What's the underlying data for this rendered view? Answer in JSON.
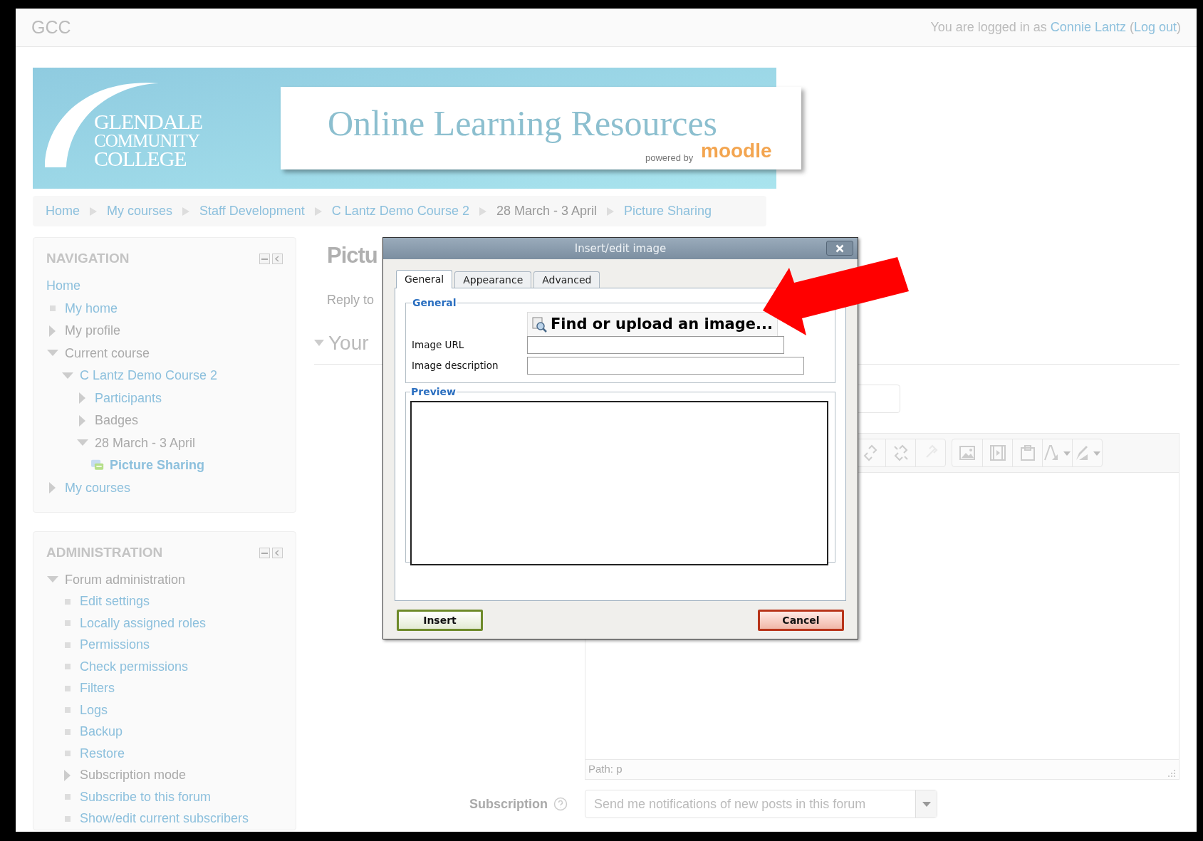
{
  "header": {
    "site": "GCC",
    "login": {
      "before": "You are logged in as",
      "user": "Connie Lantz",
      "open": "(",
      "logout": "Log out",
      "close": ")"
    }
  },
  "banner": {
    "college_lines": [
      "GLENDALE",
      "COMMUNITY",
      "COLLEGE"
    ],
    "title": "Online Learning Resources",
    "powered_by": "powered by",
    "brand": "moodle"
  },
  "breadcrumb": [
    {
      "label": "Home",
      "link": true
    },
    {
      "label": "My courses",
      "link": true
    },
    {
      "label": "Staff Development",
      "link": true
    },
    {
      "label": "C Lantz Demo Course 2",
      "link": true
    },
    {
      "label": "28 March - 3 April",
      "link": false
    },
    {
      "label": "Picture Sharing",
      "link": true
    }
  ],
  "navigation": {
    "title": "NAVIGATION",
    "items": [
      {
        "label": "Home",
        "kind": "root",
        "link": true
      },
      {
        "label": "My home",
        "kind": "leaf",
        "link": true
      },
      {
        "label": "My profile",
        "kind": "branch",
        "link": false,
        "expanded": false
      },
      {
        "label": "Current course",
        "kind": "branch",
        "link": false,
        "expanded": true,
        "children": [
          {
            "label": "C Lantz Demo Course 2",
            "kind": "branch",
            "link": true,
            "expanded": true,
            "children": [
              {
                "label": "Participants",
                "kind": "branch",
                "link": true,
                "expanded": false
              },
              {
                "label": "Badges",
                "kind": "branch",
                "link": false,
                "expanded": false
              },
              {
                "label": "28 March - 3 April",
                "kind": "branch",
                "link": false,
                "expanded": true,
                "children": [
                  {
                    "label": "Picture Sharing",
                    "kind": "activity",
                    "link": true
                  }
                ]
              }
            ]
          }
        ]
      },
      {
        "label": "My courses",
        "kind": "branch",
        "link": true,
        "expanded": false
      }
    ]
  },
  "administration": {
    "title": "ADMINISTRATION",
    "items": [
      {
        "label": "Forum administration",
        "kind": "branch",
        "link": false,
        "expanded": true,
        "children": [
          {
            "label": "Edit settings",
            "kind": "leaf",
            "link": true
          },
          {
            "label": "Locally assigned roles",
            "kind": "leaf",
            "link": true
          },
          {
            "label": "Permissions",
            "kind": "leaf",
            "link": true
          },
          {
            "label": "Check permissions",
            "kind": "leaf",
            "link": true
          },
          {
            "label": "Filters",
            "kind": "leaf",
            "link": true
          },
          {
            "label": "Logs",
            "kind": "leaf",
            "link": true
          },
          {
            "label": "Backup",
            "kind": "leaf",
            "link": true
          },
          {
            "label": "Restore",
            "kind": "leaf",
            "link": true
          },
          {
            "label": "Subscription mode",
            "kind": "branch",
            "link": false,
            "expanded": false
          },
          {
            "label": "Subscribe to this forum",
            "kind": "leaf",
            "link": true
          },
          {
            "label": "Show/edit current subscribers",
            "kind": "leaf",
            "link": true
          }
        ]
      }
    ]
  },
  "main": {
    "heading": "Pictu",
    "reply": "Reply to",
    "section": {
      "label": "Your",
      "expanded": true
    },
    "editor_path": "Path: p",
    "subscription": {
      "label": "Subscription",
      "value": "Send me notifications of new posts in this forum"
    }
  },
  "dialog": {
    "title": "Insert/edit image",
    "tabs": [
      {
        "label": "General",
        "selected": true
      },
      {
        "label": "Appearance",
        "selected": false
      },
      {
        "label": "Advanced",
        "selected": false
      }
    ],
    "general_legend": "General",
    "find_button": "Find or upload an image...",
    "fields": [
      {
        "label": "Image URL"
      },
      {
        "label": "Image description"
      }
    ],
    "preview_legend": "Preview",
    "buttons": [
      {
        "label": "Insert",
        "kind": "confirm"
      },
      {
        "label": "Cancel",
        "kind": "cancel"
      }
    ]
  }
}
